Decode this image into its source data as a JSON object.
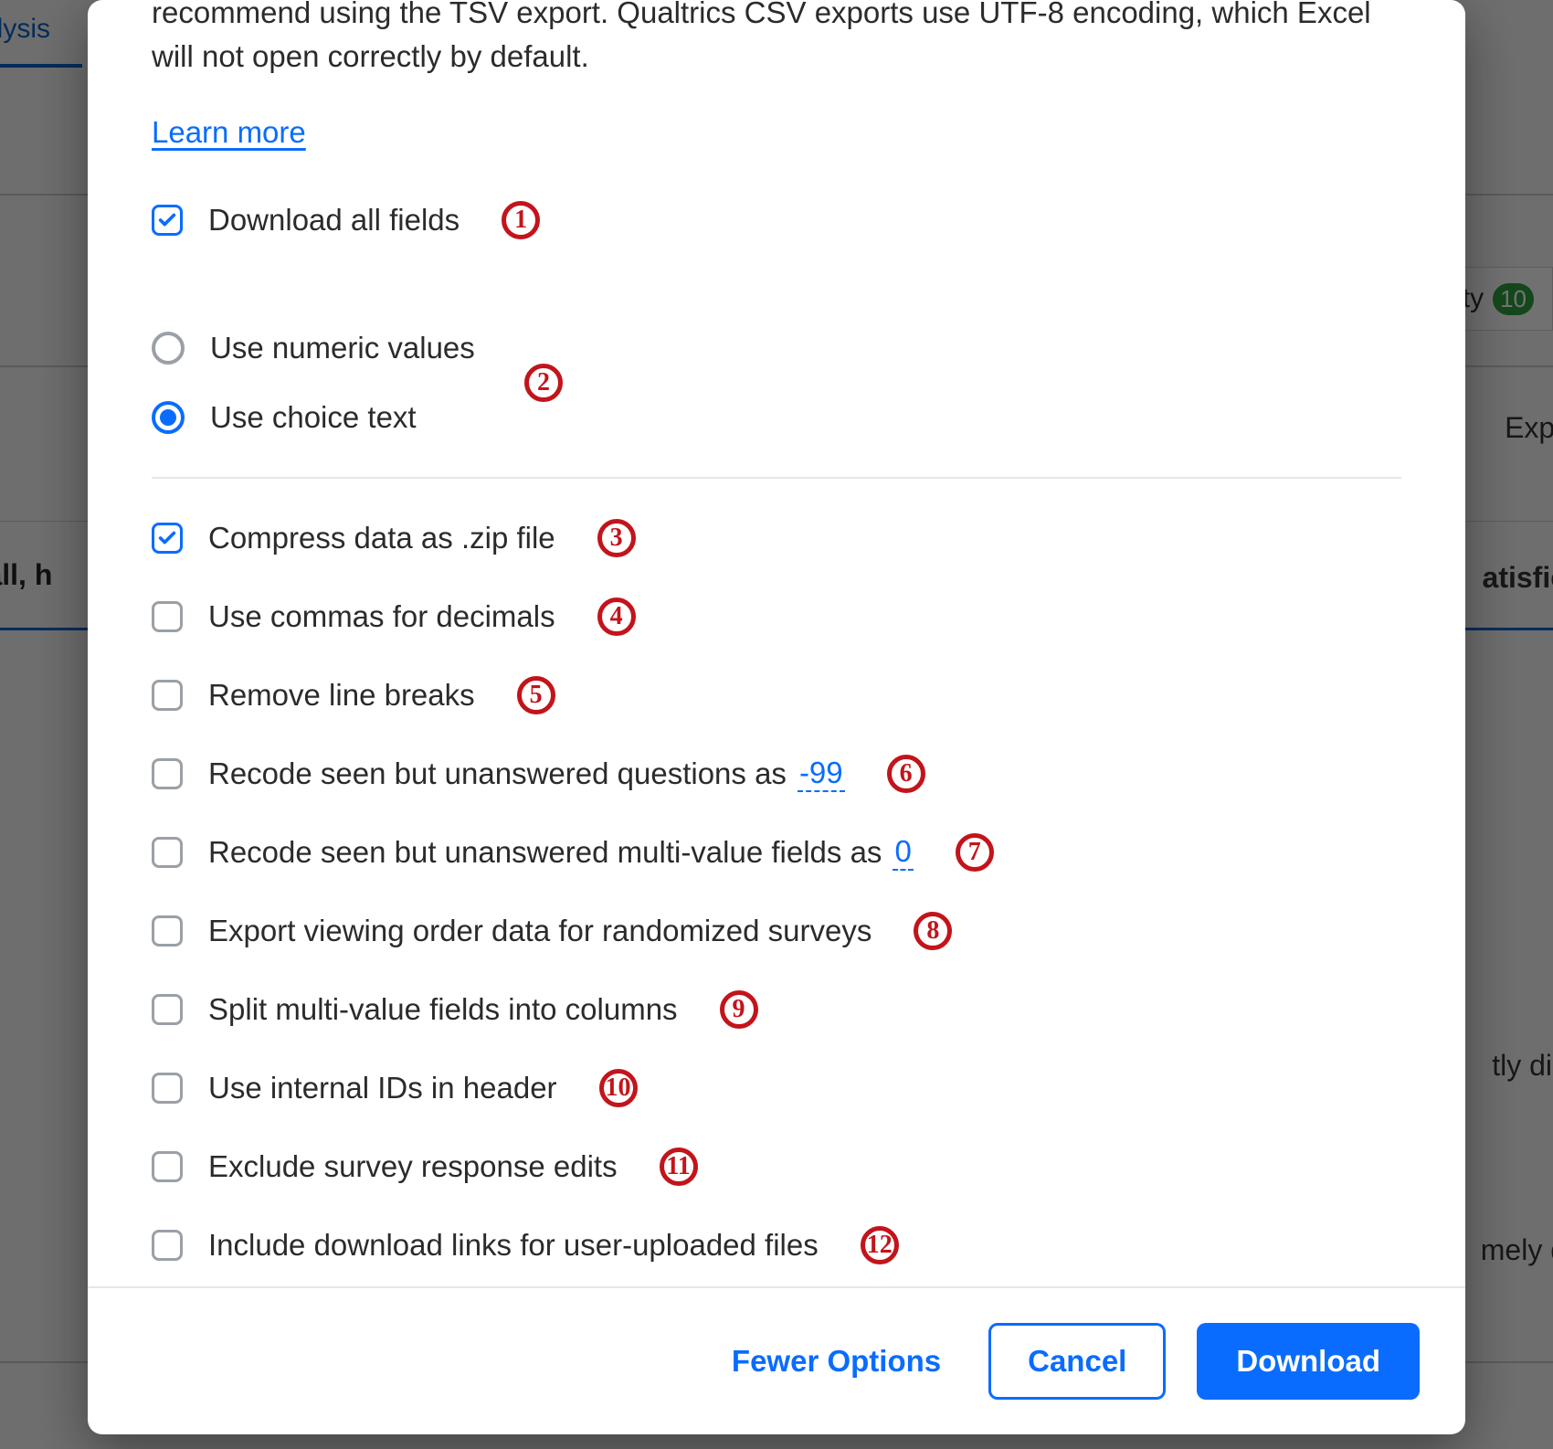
{
  "background": {
    "tab": "alysis",
    "pill_label": "lity",
    "pill_badge": "10",
    "export_fragment": "Expo",
    "question_fragment": "rall, h",
    "answer_frag_1": "atisfie",
    "answer_frag_2": "tly dis",
    "answer_frag_3": "mely d"
  },
  "modal": {
    "description": "recommend using the TSV export. Qualtrics CSV exports use UTF-8 encoding, which Excel will not open correctly by default.",
    "learn_more": "Learn more",
    "download_all_fields": "Download all fields",
    "radio_numeric": "Use numeric values",
    "radio_text": "Use choice text",
    "options": [
      {
        "label": "Compress data as .zip file",
        "checked": true
      },
      {
        "label": "Use commas for decimals",
        "checked": false
      },
      {
        "label": "Remove line breaks",
        "checked": false
      },
      {
        "label_pre": "Recode seen but unanswered questions as",
        "value": "-99",
        "checked": false
      },
      {
        "label_pre": "Recode seen but unanswered multi-value fields as",
        "value": "0",
        "checked": false
      },
      {
        "label": "Export viewing order data for randomized surveys",
        "checked": false
      },
      {
        "label": "Split multi-value fields into columns",
        "checked": false
      },
      {
        "label": "Use internal IDs in header",
        "checked": false
      },
      {
        "label": "Exclude survey response edits",
        "checked": false
      },
      {
        "label": "Include download links for user-uploaded files",
        "checked": false
      }
    ],
    "annotations": [
      "1",
      "2",
      "3",
      "4",
      "5",
      "6",
      "7",
      "8",
      "9",
      "10",
      "11",
      "12"
    ],
    "footer": {
      "fewer": "Fewer Options",
      "cancel": "Cancel",
      "download": "Download"
    }
  }
}
